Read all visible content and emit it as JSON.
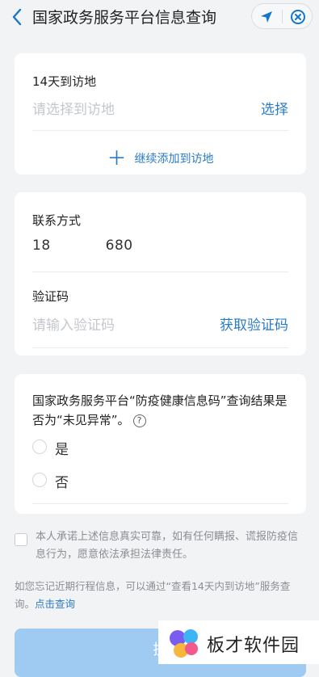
{
  "header": {
    "back_icon": "chevron-left-icon",
    "title": "国家政务服务平台信息查询",
    "location_icon": "location-arrow-icon",
    "close_icon": "close-circle-icon"
  },
  "visit": {
    "label": "14天到访地",
    "placeholder": "请选择到访地",
    "select_label": "选择",
    "add_label": "继续添加到访地"
  },
  "contact": {
    "label": "联系方式",
    "phone_prefix": "18",
    "phone_suffix": "680",
    "code_label": "验证码",
    "code_placeholder": "请输入验证码",
    "get_code_label": "获取验证码"
  },
  "question": {
    "text": "国家政务服务平台“防疫健康信息码”查询结果是否为“未见异常”。",
    "help_icon": "question-circle-icon",
    "options": [
      "是",
      "否"
    ]
  },
  "agreement": {
    "text": "本人承诺上述信息真实可靠，如有任何瞒报、谎报防疫信息行为，愿意依法承担法律责任。"
  },
  "tip": {
    "text": "如您忘记近期行程信息，可以通过“查看14天内到访地”服务查询。",
    "link": "点击查询"
  },
  "submit": {
    "label": "提"
  },
  "watermark": {
    "logo_icon": "bancai-logo",
    "text": "板才软件园"
  },
  "colors": {
    "accent": "#2b7bc4",
    "background": "#f2f3f5",
    "submit_disabled": "#9fcbf2"
  }
}
